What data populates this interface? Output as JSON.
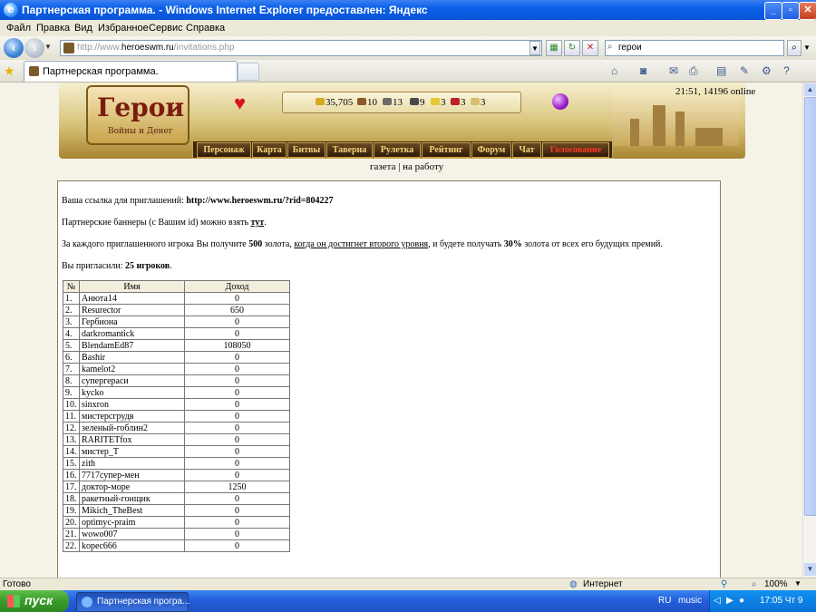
{
  "window": {
    "title": "Партнерская программа. - Windows Internet Explorer предоставлен: Яндекс",
    "buttons": {
      "minimize": "_",
      "restore": "▫",
      "close": "✕"
    }
  },
  "menu": [
    "Файл",
    "Правка",
    "Вид",
    "Избранное",
    "Сервис",
    "Справка"
  ],
  "address": {
    "prefix": "http://www.",
    "host": "heroeswm.ru",
    "path": "/invitations.php"
  },
  "search": {
    "value": "герои"
  },
  "tab": {
    "label": "Партнерская программа."
  },
  "page": {
    "online": "21:51, 14196 online",
    "logo": {
      "title": "Герои",
      "subtitle": "Войны и Денег"
    },
    "resources": [
      {
        "value": "35,705",
        "color": "#d6a91c"
      },
      {
        "value": "10",
        "color": "#8a5a2a"
      },
      {
        "value": "13",
        "color": "#6a6a6a"
      },
      {
        "value": "9",
        "color": "#4a4a4a"
      },
      {
        "value": "3",
        "color": "#e8c830"
      },
      {
        "value": "3",
        "color": "#c0202a"
      },
      {
        "value": "3",
        "color": "#d8c070"
      }
    ],
    "nav": [
      "Персонаж",
      "Карта",
      "Битвы",
      "Таверна",
      "Рулетка",
      "Рейтинг",
      "Форум",
      "Чат",
      "Голосование"
    ],
    "sublinks": {
      "gazeta": "газета",
      "sep": " | ",
      "work": "на работу"
    },
    "invite": {
      "label": "Ваша ссылка для приглашений: ",
      "link": "http://www.heroeswm.ru/?rid=804227"
    },
    "banners": {
      "text": "Партнерские баннеры (с Вашим id) можно взять ",
      "link": "тут",
      "end": "."
    },
    "reward": {
      "p1": "За каждого приглашенного игрока Вы получите ",
      "gold": "500",
      "p2": " золота, ",
      "cond": "когда он достигнет второго уровня",
      "p3": ", и будете получать ",
      "pct": "30%",
      "p4": " золота от всех его будущих премий."
    },
    "invited": {
      "label": "Вы пригласили: ",
      "count": "25 игроков",
      "end": "."
    },
    "table": {
      "headers": [
        "№",
        "Имя",
        "Доход"
      ],
      "rows": [
        [
          "1.",
          "Анюта14",
          "0"
        ],
        [
          "2.",
          "Resurector",
          "650"
        ],
        [
          "3.",
          "Гербиона",
          "0"
        ],
        [
          "4.",
          "darkromantick",
          "0"
        ],
        [
          "5.",
          "BlendamEd87",
          "108050"
        ],
        [
          "6.",
          "Bashir",
          "0"
        ],
        [
          "7.",
          "kamelot2",
          "0"
        ],
        [
          "8.",
          "супергераси",
          "0"
        ],
        [
          "9.",
          "kycko",
          "0"
        ],
        [
          "10.",
          "sinxron",
          "0"
        ],
        [
          "11.",
          "мистерсгрудв",
          "0"
        ],
        [
          "12.",
          "зеленый-гоблин2",
          "0"
        ],
        [
          "13.",
          "RARITETfox",
          "0"
        ],
        [
          "14.",
          "мистер_T",
          "0"
        ],
        [
          "15.",
          "zith",
          "0"
        ],
        [
          "16.",
          "7717супер-мен",
          "0"
        ],
        [
          "17.",
          "доктор-море",
          "1250"
        ],
        [
          "18.",
          "ракетный-гонщик",
          "0"
        ],
        [
          "19.",
          "Mikich_TheBest",
          "0"
        ],
        [
          "20.",
          "optimyc-praim",
          "0"
        ],
        [
          "21.",
          "wowo007",
          "0"
        ],
        [
          "22.",
          "kopec666",
          "0"
        ]
      ]
    }
  },
  "status": {
    "left": "Готово",
    "zone": "Интернет",
    "zoom": "100%"
  },
  "taskbar": {
    "start": "пуск",
    "item": "Партнерская програ...",
    "lang": "RU",
    "music": "music",
    "time": "17:05 Чт 9"
  }
}
